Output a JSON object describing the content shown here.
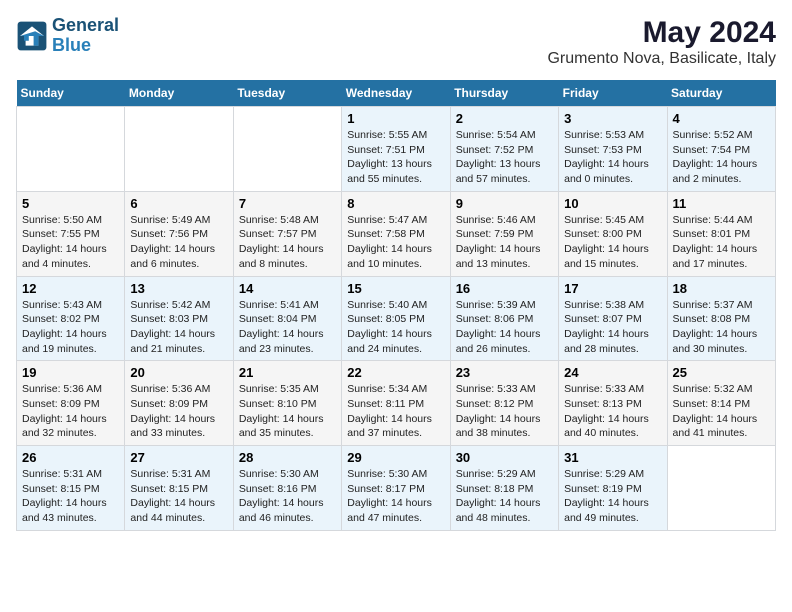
{
  "header": {
    "logo_line1": "General",
    "logo_line2": "Blue",
    "title": "May 2024",
    "subtitle": "Grumento Nova, Basilicate, Italy"
  },
  "weekdays": [
    "Sunday",
    "Monday",
    "Tuesday",
    "Wednesday",
    "Thursday",
    "Friday",
    "Saturday"
  ],
  "weeks": [
    [
      {
        "day": "",
        "info": ""
      },
      {
        "day": "",
        "info": ""
      },
      {
        "day": "",
        "info": ""
      },
      {
        "day": "1",
        "info": "Sunrise: 5:55 AM\nSunset: 7:51 PM\nDaylight: 13 hours\nand 55 minutes."
      },
      {
        "day": "2",
        "info": "Sunrise: 5:54 AM\nSunset: 7:52 PM\nDaylight: 13 hours\nand 57 minutes."
      },
      {
        "day": "3",
        "info": "Sunrise: 5:53 AM\nSunset: 7:53 PM\nDaylight: 14 hours\nand 0 minutes."
      },
      {
        "day": "4",
        "info": "Sunrise: 5:52 AM\nSunset: 7:54 PM\nDaylight: 14 hours\nand 2 minutes."
      }
    ],
    [
      {
        "day": "5",
        "info": "Sunrise: 5:50 AM\nSunset: 7:55 PM\nDaylight: 14 hours\nand 4 minutes."
      },
      {
        "day": "6",
        "info": "Sunrise: 5:49 AM\nSunset: 7:56 PM\nDaylight: 14 hours\nand 6 minutes."
      },
      {
        "day": "7",
        "info": "Sunrise: 5:48 AM\nSunset: 7:57 PM\nDaylight: 14 hours\nand 8 minutes."
      },
      {
        "day": "8",
        "info": "Sunrise: 5:47 AM\nSunset: 7:58 PM\nDaylight: 14 hours\nand 10 minutes."
      },
      {
        "day": "9",
        "info": "Sunrise: 5:46 AM\nSunset: 7:59 PM\nDaylight: 14 hours\nand 13 minutes."
      },
      {
        "day": "10",
        "info": "Sunrise: 5:45 AM\nSunset: 8:00 PM\nDaylight: 14 hours\nand 15 minutes."
      },
      {
        "day": "11",
        "info": "Sunrise: 5:44 AM\nSunset: 8:01 PM\nDaylight: 14 hours\nand 17 minutes."
      }
    ],
    [
      {
        "day": "12",
        "info": "Sunrise: 5:43 AM\nSunset: 8:02 PM\nDaylight: 14 hours\nand 19 minutes."
      },
      {
        "day": "13",
        "info": "Sunrise: 5:42 AM\nSunset: 8:03 PM\nDaylight: 14 hours\nand 21 minutes."
      },
      {
        "day": "14",
        "info": "Sunrise: 5:41 AM\nSunset: 8:04 PM\nDaylight: 14 hours\nand 23 minutes."
      },
      {
        "day": "15",
        "info": "Sunrise: 5:40 AM\nSunset: 8:05 PM\nDaylight: 14 hours\nand 24 minutes."
      },
      {
        "day": "16",
        "info": "Sunrise: 5:39 AM\nSunset: 8:06 PM\nDaylight: 14 hours\nand 26 minutes."
      },
      {
        "day": "17",
        "info": "Sunrise: 5:38 AM\nSunset: 8:07 PM\nDaylight: 14 hours\nand 28 minutes."
      },
      {
        "day": "18",
        "info": "Sunrise: 5:37 AM\nSunset: 8:08 PM\nDaylight: 14 hours\nand 30 minutes."
      }
    ],
    [
      {
        "day": "19",
        "info": "Sunrise: 5:36 AM\nSunset: 8:09 PM\nDaylight: 14 hours\nand 32 minutes."
      },
      {
        "day": "20",
        "info": "Sunrise: 5:36 AM\nSunset: 8:09 PM\nDaylight: 14 hours\nand 33 minutes."
      },
      {
        "day": "21",
        "info": "Sunrise: 5:35 AM\nSunset: 8:10 PM\nDaylight: 14 hours\nand 35 minutes."
      },
      {
        "day": "22",
        "info": "Sunrise: 5:34 AM\nSunset: 8:11 PM\nDaylight: 14 hours\nand 37 minutes."
      },
      {
        "day": "23",
        "info": "Sunrise: 5:33 AM\nSunset: 8:12 PM\nDaylight: 14 hours\nand 38 minutes."
      },
      {
        "day": "24",
        "info": "Sunrise: 5:33 AM\nSunset: 8:13 PM\nDaylight: 14 hours\nand 40 minutes."
      },
      {
        "day": "25",
        "info": "Sunrise: 5:32 AM\nSunset: 8:14 PM\nDaylight: 14 hours\nand 41 minutes."
      }
    ],
    [
      {
        "day": "26",
        "info": "Sunrise: 5:31 AM\nSunset: 8:15 PM\nDaylight: 14 hours\nand 43 minutes."
      },
      {
        "day": "27",
        "info": "Sunrise: 5:31 AM\nSunset: 8:15 PM\nDaylight: 14 hours\nand 44 minutes."
      },
      {
        "day": "28",
        "info": "Sunrise: 5:30 AM\nSunset: 8:16 PM\nDaylight: 14 hours\nand 46 minutes."
      },
      {
        "day": "29",
        "info": "Sunrise: 5:30 AM\nSunset: 8:17 PM\nDaylight: 14 hours\nand 47 minutes."
      },
      {
        "day": "30",
        "info": "Sunrise: 5:29 AM\nSunset: 8:18 PM\nDaylight: 14 hours\nand 48 minutes."
      },
      {
        "day": "31",
        "info": "Sunrise: 5:29 AM\nSunset: 8:19 PM\nDaylight: 14 hours\nand 49 minutes."
      },
      {
        "day": "",
        "info": ""
      }
    ]
  ]
}
